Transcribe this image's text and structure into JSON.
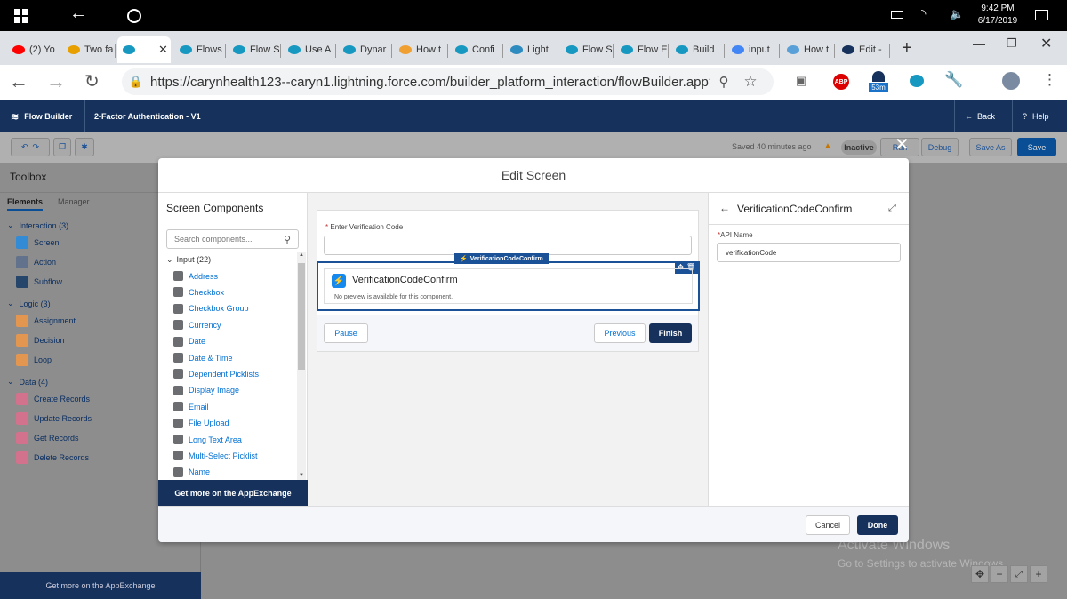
{
  "taskbar": {
    "time": "9:42 PM",
    "date": "6/17/2019"
  },
  "tabs": [
    {
      "label": "(2) Yo",
      "color": "#ff0000"
    },
    {
      "label": "Two fa",
      "color": "#e8a000"
    },
    {
      "label": "",
      "color": "#1798c1"
    },
    {
      "label": "Flows",
      "color": "#1798c1"
    },
    {
      "label": "Flow S",
      "color": "#1798c1"
    },
    {
      "label": "Use A",
      "color": "#1798c1"
    },
    {
      "label": "Dynar",
      "color": "#1798c1"
    },
    {
      "label": "How t",
      "color": "#f0a030"
    },
    {
      "label": "Confi",
      "color": "#1798c1"
    },
    {
      "label": "Light",
      "color": "#2e8bc0"
    },
    {
      "label": "Flow S",
      "color": "#1798c1"
    },
    {
      "label": "Flow E",
      "color": "#1798c1"
    },
    {
      "label": "Build",
      "color": "#1798c1"
    },
    {
      "label": "input",
      "color": "#4285f4"
    },
    {
      "label": "How t",
      "color": "#5aa0d8"
    },
    {
      "label": "Edit -",
      "color": "#16325c"
    }
  ],
  "address": {
    "url": "https://carynhealth123--caryn1.lightning.force.com/builder_platform_interaction/flowBuilder.app?flowId...",
    "badge": "53m"
  },
  "header": {
    "app": "Flow Builder",
    "flow_name": "2-Factor Authentication - V1",
    "back_label": "Back",
    "help_label": "Help"
  },
  "toolbar": {
    "saved_text": "Saved 40 minutes ago",
    "status": "Inactive",
    "run_label": "Run",
    "debug_label": "Debug",
    "save_as_label": "Save As",
    "save_label": "Save"
  },
  "toolbox": {
    "title": "Toolbox",
    "tabs": [
      "Elements",
      "Manager"
    ],
    "groups": [
      {
        "label": "Interaction (3)",
        "items": [
          {
            "label": "Screen",
            "color": "#1589ee"
          },
          {
            "label": "Action",
            "color": "#54698d"
          },
          {
            "label": "Subflow",
            "color": "#032d60"
          }
        ]
      },
      {
        "label": "Logic (3)",
        "items": [
          {
            "label": "Assignment",
            "color": "#ff9a3c"
          },
          {
            "label": "Decision",
            "color": "#ff9a3c"
          },
          {
            "label": "Loop",
            "color": "#ff9a3c"
          }
        ]
      },
      {
        "label": "Data (4)",
        "items": [
          {
            "label": "Create Records",
            "color": "#ea6a8e"
          },
          {
            "label": "Update Records",
            "color": "#ea6a8e"
          },
          {
            "label": "Get Records",
            "color": "#ea6a8e"
          },
          {
            "label": "Delete Records",
            "color": "#ea6a8e"
          }
        ]
      }
    ],
    "appexchange": "Get more on the AppExchange"
  },
  "modal": {
    "title": "Edit Screen",
    "components": {
      "title": "Screen Components",
      "search_placeholder": "Search components...",
      "group": "Input (22)",
      "items": [
        "Address",
        "Checkbox",
        "Checkbox Group",
        "Currency",
        "Date",
        "Date & Time",
        "Dependent Picklists",
        "Display Image",
        "Email",
        "File Upload",
        "Long Text Area",
        "Multi-Select Picklist",
        "Name"
      ],
      "appexchange": "Get more on the AppExchange"
    },
    "canvas": {
      "field_label": "Enter Verification Code",
      "selected_tag": "VerificationCodeConfirm",
      "component_title": "VerificationCodeConfirm",
      "component_note": "No preview is available for this component.",
      "pause_label": "Pause",
      "previous_label": "Previous",
      "finish_label": "Finish"
    },
    "properties": {
      "title": "VerificationCodeConfirm",
      "api_label": "API Name",
      "api_value": "verificationCode"
    },
    "cancel_label": "Cancel",
    "done_label": "Done"
  },
  "watermark": {
    "line1": "Activate Windows",
    "line2": "Go to Settings to activate Windows."
  }
}
